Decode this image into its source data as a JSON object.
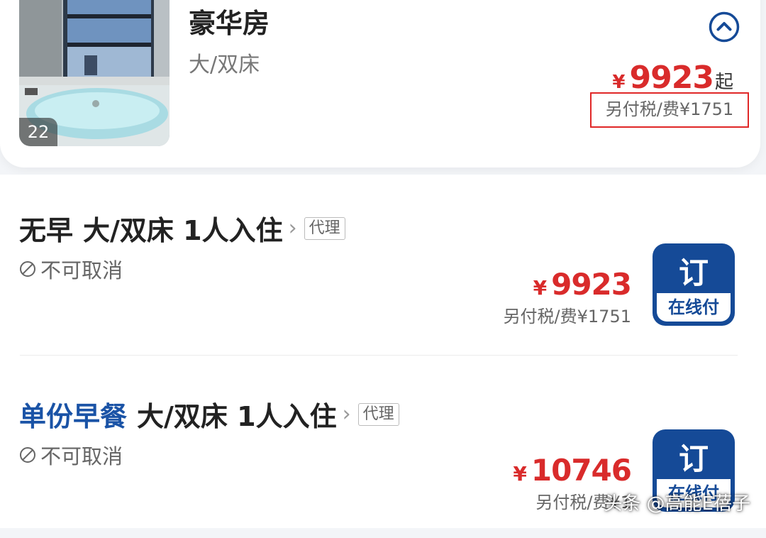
{
  "room": {
    "photo_count": "22",
    "title": "豪华房",
    "bed": "大/双床",
    "price_currency": "¥",
    "price": "9923",
    "price_suffix": "起",
    "tax_note": "另付税/费¥1751"
  },
  "rates": [
    {
      "meal": "无早",
      "bed_occupancy": "大/双床 1人入住",
      "agent_tag": "代理",
      "cancel_policy": "不可取消",
      "currency": "¥",
      "price": "9923",
      "tax_note": "另付税/费¥1751",
      "book_label": "订",
      "pay_label": "在线付"
    },
    {
      "meal": "单份早餐",
      "bed_occupancy": "大/双床 1人入住",
      "agent_tag": "代理",
      "cancel_policy": "不可取消",
      "currency": "¥",
      "price": "10746",
      "tax_note": "另付税/费¥1",
      "book_label": "订",
      "pay_label": "在线付"
    }
  ],
  "watermark": "头条 @高能E蓓子",
  "colors": {
    "price_red": "#d92b2b",
    "brand_blue": "#154a97",
    "highlight_box": "#e02727"
  },
  "icons": {
    "collapse": "chevron-up-circle-icon",
    "cancel": "ban-icon",
    "more": "chevron-right-icon"
  }
}
